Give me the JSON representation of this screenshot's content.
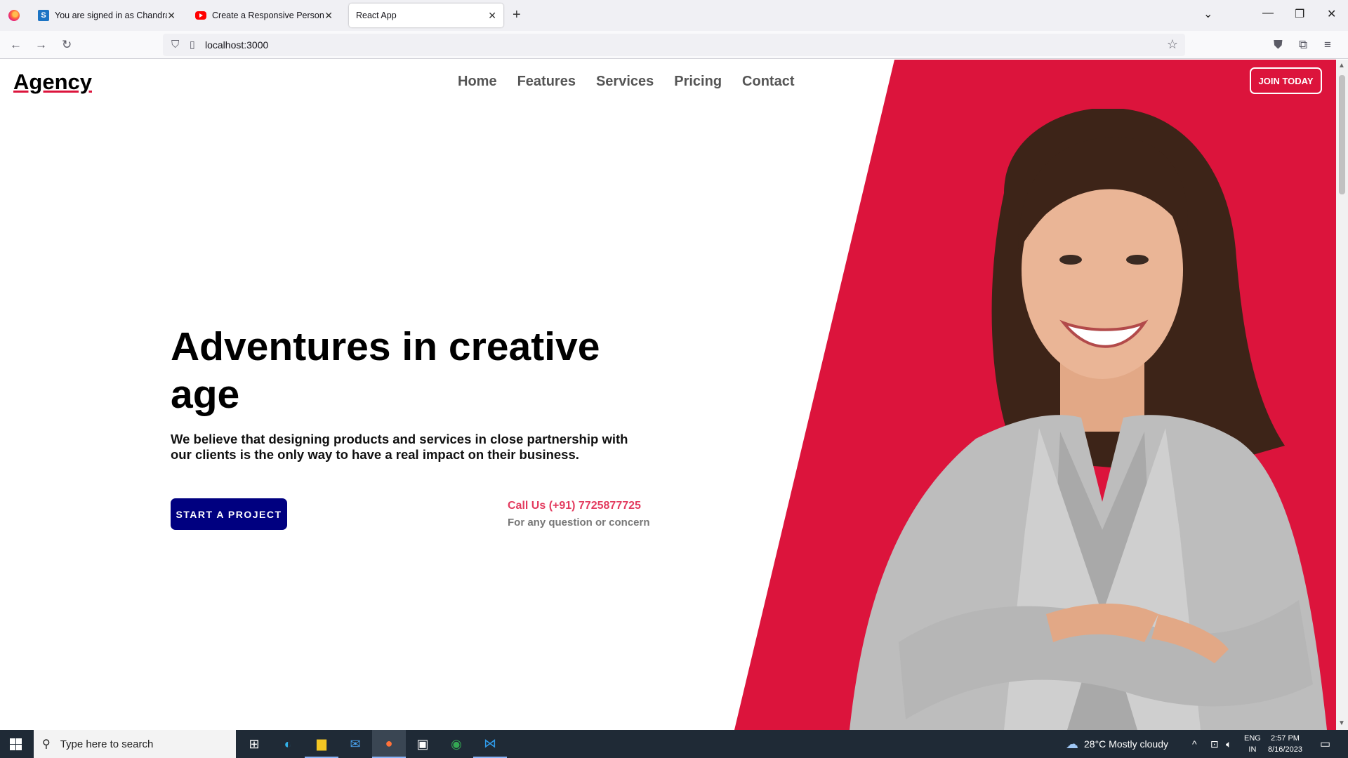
{
  "browser": {
    "tabs": [
      {
        "title": "You are signed in as Chandrakant",
        "favicon": "s-favicon",
        "active": false
      },
      {
        "title": "Create a Responsive Personal Portfolio",
        "favicon": "youtube-favicon",
        "active": false
      },
      {
        "title": "React App",
        "favicon": "",
        "active": true
      }
    ],
    "url": "localhost:3000"
  },
  "site": {
    "logo": "Agency",
    "nav": [
      "Home",
      "Features",
      "Services",
      "Pricing",
      "Contact"
    ],
    "join_label": "JOIN TODAY",
    "hero_title": "Adventures in creative age",
    "hero_desc": "We believe that designing products and services in close partnership with our clients is the only way to have a real impact on their business.",
    "start_label": "START A PROJECT",
    "call_title": "Call Us (+91) 7725877725",
    "call_sub": "For any question or concern",
    "accent_color": "#dc143c",
    "button_color": "#000080"
  },
  "taskbar": {
    "search_placeholder": "Type here to search",
    "weather": "28°C  Mostly cloudy",
    "lang_top": "ENG",
    "lang_bottom": "IN",
    "time": "2:57 PM",
    "date": "8/16/2023"
  }
}
